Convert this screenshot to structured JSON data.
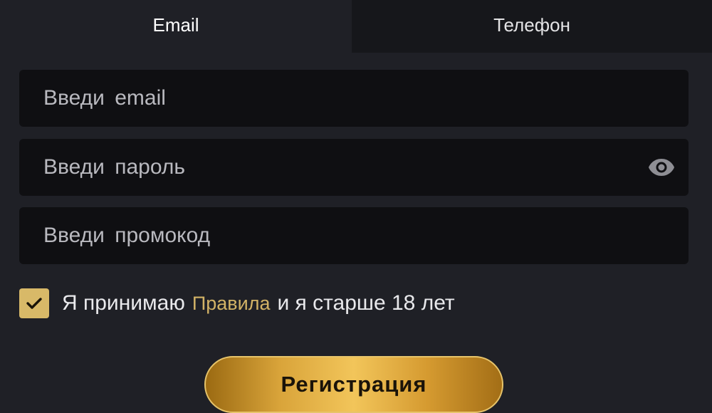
{
  "tabs": {
    "email": "Email",
    "phone": "Телефон"
  },
  "form": {
    "email_placeholder": "Введи email",
    "email_value": "",
    "password_placeholder": "Введи пароль",
    "password_value": "",
    "promo_placeholder": "Введи промокод",
    "promo_value": ""
  },
  "agreement": {
    "checked": true,
    "prefix": "Я принимаю",
    "rules_link": "Правила",
    "suffix": "и я старше 18 лет"
  },
  "register_label": "Регистрация",
  "icons": {
    "password_toggle": "eye-icon",
    "checkbox": "checkmark-icon"
  },
  "colors": {
    "background": "#1f2026",
    "input_background": "#0f0f12",
    "inactive_tab": "#16171b",
    "accent_gold": "#d8b968",
    "link_gold": "#d2b266"
  }
}
